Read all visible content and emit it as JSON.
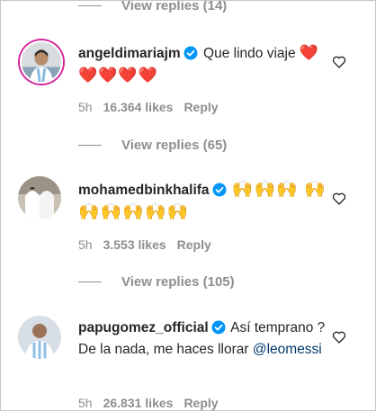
{
  "comments": [
    {
      "username": "angeldimariajm",
      "text": "Que lindo viaje",
      "hearts": "❤️❤️❤️❤️❤️",
      "time": "5h",
      "likes": "16.364 likes",
      "reply": "Reply",
      "view_replies": "View replies (65)"
    },
    {
      "username": "mohamedbinkhalifa",
      "emoji": "🙌🙌🙌 🙌🙌🙌🙌🙌🙌",
      "time": "5h",
      "likes": "3.553 likes",
      "reply": "Reply",
      "view_replies": "View replies (105)"
    },
    {
      "username": "papugomez_official",
      "text": "Así temprano ? De la nada, me haces llorar",
      "mention": "@leomessi",
      "time": "5h",
      "likes": "26.831 likes",
      "reply": "Reply"
    }
  ],
  "top_view_replies": "View replies (14)",
  "colors": {
    "text": "#262626",
    "muted": "#8e8e8e",
    "verified": "#0095f6",
    "mention": "#00376b",
    "heart": "#ed1c24",
    "story_ring": "#d6249f"
  },
  "icons": [
    "verified-badge-icon",
    "heart-outline-icon"
  ]
}
